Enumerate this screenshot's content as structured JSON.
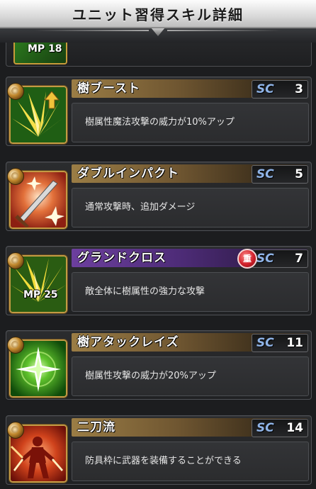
{
  "header": {
    "title": "ユニット習得スキル詳細"
  },
  "partial": {
    "mp": "MP 18"
  },
  "skills": [
    {
      "name": "樹ブースト",
      "sc_label": "SC",
      "sc": "3",
      "desc": "樹属性魔法攻撃の威力が10%アップ",
      "mp": "",
      "icon": "green-boost-icon"
    },
    {
      "name": "ダブルインパクト",
      "sc_label": "SC",
      "sc": "5",
      "desc": "通常攻撃時、追加ダメージ",
      "mp": "",
      "icon": "double-sword-icon"
    },
    {
      "name": "グランドクロス",
      "sc_label": "SC",
      "sc": "7",
      "desc": "敵全体に樹属性の強力な攻撃",
      "mp": "MP 25",
      "heavy": "重",
      "icon": "grand-cross-icon"
    },
    {
      "name": "樹アタックレイズ",
      "sc_label": "SC",
      "sc": "11",
      "desc": "樹属性攻撃の威力が20%アップ",
      "mp": "",
      "icon": "green-star-icon"
    },
    {
      "name": "二刀流",
      "sc_label": "SC",
      "sc": "14",
      "desc": "防具枠に武器を装備することができる",
      "mp": "",
      "icon": "dual-wield-icon"
    }
  ]
}
